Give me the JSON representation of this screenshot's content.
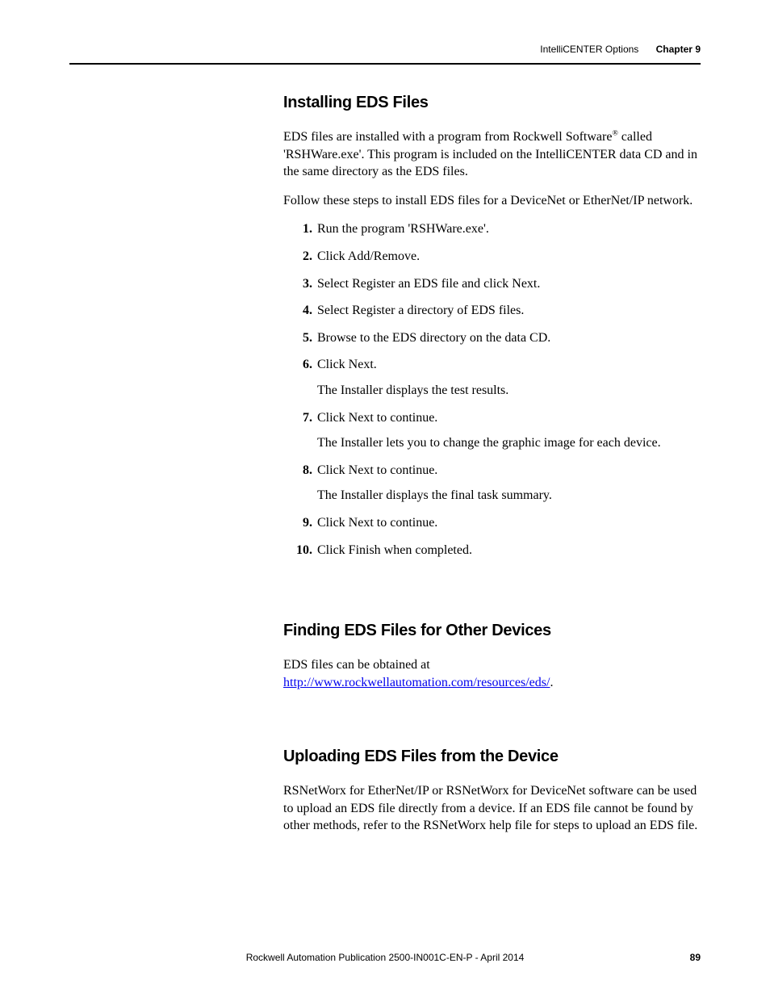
{
  "header": {
    "section": "IntelliCENTER Options",
    "chapter": "Chapter 9"
  },
  "sections": {
    "s1": {
      "heading": "Installing EDS Files",
      "p1_a": "EDS files are installed with a program from Rockwell Software",
      "p1_b": " called 'RSHWare.exe'. This program is included on the IntelliCENTER data CD and in the same directory as the EDS files.",
      "p2": "Follow these steps to install EDS files for a DeviceNet or EtherNet/IP network.",
      "steps": {
        "n1": "1.",
        "s1": "Run the program 'RSHWare.exe'.",
        "n2": "2.",
        "s2": "Click Add/Remove.",
        "n3": "3.",
        "s3": "Select Register an EDS file and click Next.",
        "n4": "4.",
        "s4": "Select Register a directory of EDS files.",
        "n5": "5.",
        "s5": "Browse to the EDS directory on the data CD.",
        "n6": "6.",
        "s6": "Click Next.",
        "s6b": "The Installer displays the test results.",
        "n7": "7.",
        "s7": "Click Next to continue.",
        "s7b": "The Installer lets you to change the graphic image for each device.",
        "n8": "8.",
        "s8": "Click Next to continue.",
        "s8b": "The Installer displays the final task summary.",
        "n9": "9.",
        "s9": "Click Next to continue.",
        "n10": "10.",
        "s10": "Click Finish when completed."
      }
    },
    "s2": {
      "heading": "Finding EDS Files for Other Devices",
      "p1_a": "EDS files can be obtained at ",
      "link": "http://www.rockwellautomation.com/resources/eds/",
      "p1_b": "."
    },
    "s3": {
      "heading": "Uploading EDS Files from the Device",
      "p1": "RSNetWorx for EtherNet/IP or RSNetWorx for DeviceNet software can be used to upload an EDS file directly from a device. If an EDS file cannot be found by other methods, refer to the RSNetWorx help file for steps to upload an EDS file."
    }
  },
  "footer": {
    "publication": "Rockwell Automation Publication 2500-IN001C-EN-P - April 2014",
    "page": "89"
  }
}
